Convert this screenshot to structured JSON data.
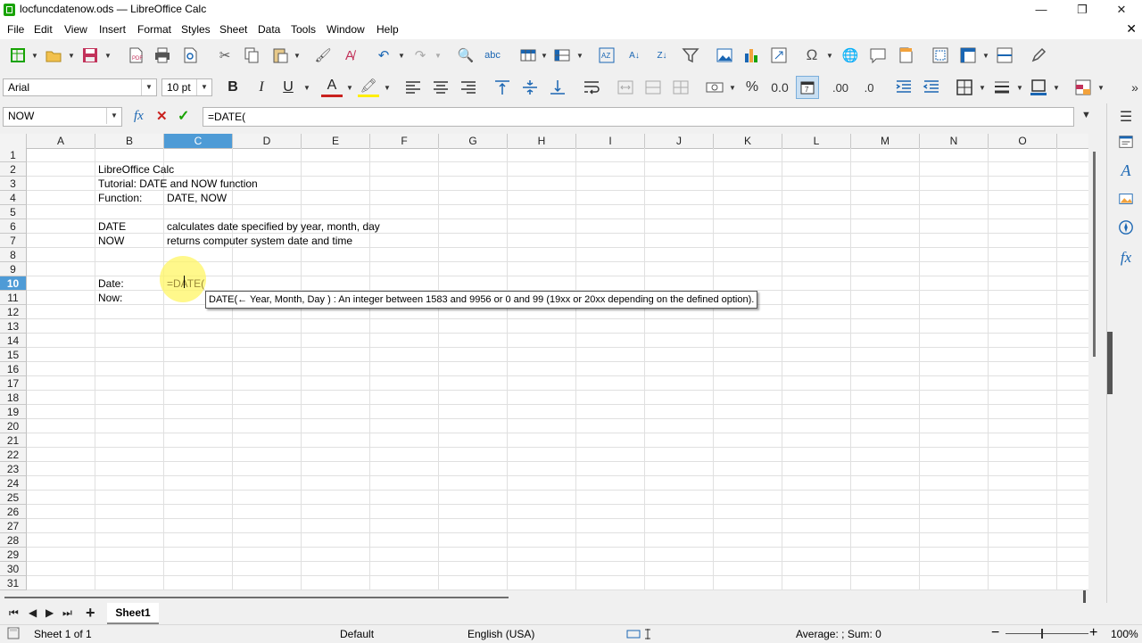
{
  "window": {
    "title": "locfuncdatenow.ods — LibreOffice Calc",
    "minimize": "—",
    "maximize": "❐",
    "close": "✕",
    "accent": "#18a303"
  },
  "menubar": {
    "items": [
      "File",
      "Edit",
      "View",
      "Insert",
      "Format",
      "Styles",
      "Sheet",
      "Data",
      "Tools",
      "Window",
      "Help"
    ],
    "close": "✕"
  },
  "toolbar": {
    "font_name": "Arial",
    "font_size": "10 pt",
    "bold": "B",
    "italic": "I",
    "underline": "U",
    "percent": "%",
    "number_format": "0.0",
    "add_decimal": ".00",
    "remove_decimal": ".0"
  },
  "formula_bar": {
    "name_box": "NOW",
    "content": "=DATE(",
    "function_icon": "fx",
    "cancel": "✕",
    "accept": "✓"
  },
  "grid": {
    "columns": [
      "A",
      "B",
      "C",
      "D",
      "E",
      "F",
      "G",
      "H",
      "I",
      "J",
      "K",
      "L",
      "M",
      "N",
      "O"
    ],
    "selected_column": "C",
    "rows": [
      "1",
      "2",
      "3",
      "4",
      "5",
      "6",
      "7",
      "8",
      "9",
      "10",
      "11",
      "12",
      "13",
      "14",
      "15",
      "16",
      "17",
      "18",
      "19",
      "20",
      "21",
      "22",
      "23",
      "24",
      "25",
      "26",
      "27",
      "28",
      "29",
      "30",
      "31"
    ],
    "selected_row": "10",
    "cells": {
      "B2": "LibreOffice Calc",
      "B3": "Tutorial: DATE and NOW function",
      "B4": "Function:",
      "C4": "DATE, NOW",
      "B6": "DATE",
      "C6": "calculates date specified by year, month, day",
      "B7": "NOW",
      "C7": "returns computer system date and time",
      "B10": "Date:",
      "C10": "=DATE(",
      "B11": "Now:"
    },
    "tooltip": "DATE(← Year, Month, Day ) : An integer between 1583 and 9956 or 0 and 99 (19xx or 20xx depending on the defined option)."
  },
  "sheet_tabs": {
    "add": "+",
    "tabs": [
      "Sheet1"
    ]
  },
  "status_bar": {
    "sheet_info": "Sheet 1 of 1",
    "page_style": "Default",
    "language": "English (USA)",
    "summary": "Average: ; Sum: 0",
    "zoom_minus": "−",
    "zoom_plus": "+",
    "zoom": "100%"
  }
}
